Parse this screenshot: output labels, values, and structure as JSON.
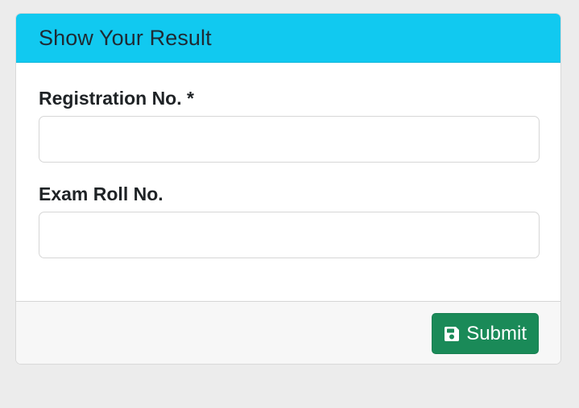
{
  "card": {
    "title": "Show Your Result"
  },
  "form": {
    "registration_label": "Registration No. *",
    "registration_value": "",
    "exam_roll_label": "Exam Roll No.",
    "exam_roll_value": ""
  },
  "footer": {
    "submit_label": "Submit",
    "submit_icon": "floppy-disk-save-icon"
  },
  "colors": {
    "header_bg": "#11c9f0",
    "submit_bg": "#1a8a58",
    "page_bg": "#ececec"
  }
}
